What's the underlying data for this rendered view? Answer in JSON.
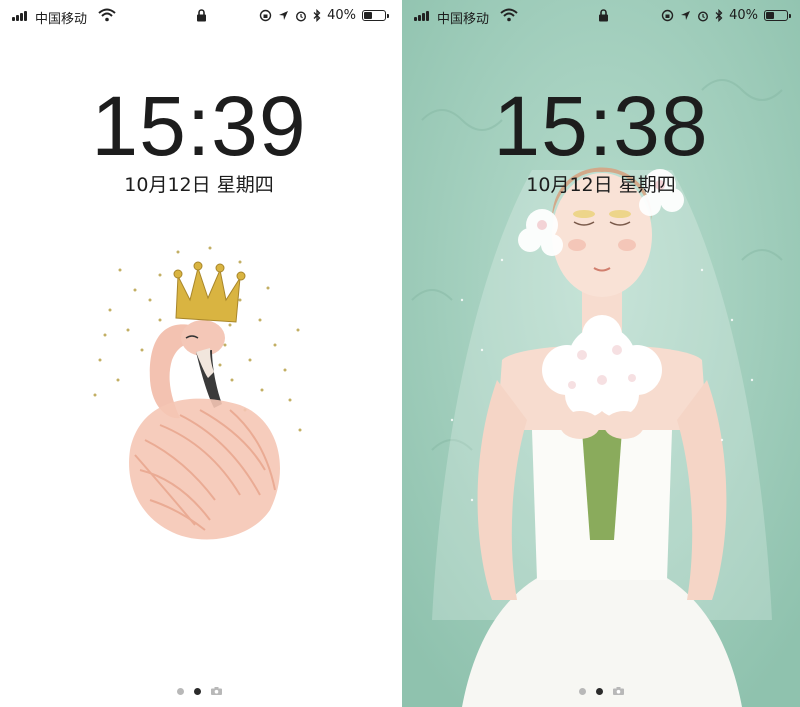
{
  "screens": [
    {
      "carrier": "中国移动",
      "time": "15:39",
      "date": "10月12日 星期四",
      "battery_percent": "40%",
      "battery_level": 0.4,
      "wallpaper": "flamingo-with-crown",
      "page_dots_active": 1
    },
    {
      "carrier": "中国移动",
      "time": "15:38",
      "date": "10月12日 星期四",
      "battery_percent": "40%",
      "battery_level": 0.4,
      "wallpaper": "bride-with-bouquet",
      "page_dots_active": 1
    }
  ],
  "colors": {
    "right_background": "#9fcdbb",
    "flamingo_pink": "#f2b8a6",
    "crown_gold": "#d9b441",
    "dress_white": "#f7f7f3"
  },
  "icons": [
    "signal-icon",
    "wifi-icon",
    "lock-icon",
    "orientation-lock-icon",
    "location-icon",
    "alarm-icon",
    "bluetooth-icon",
    "battery-icon",
    "camera-icon"
  ]
}
